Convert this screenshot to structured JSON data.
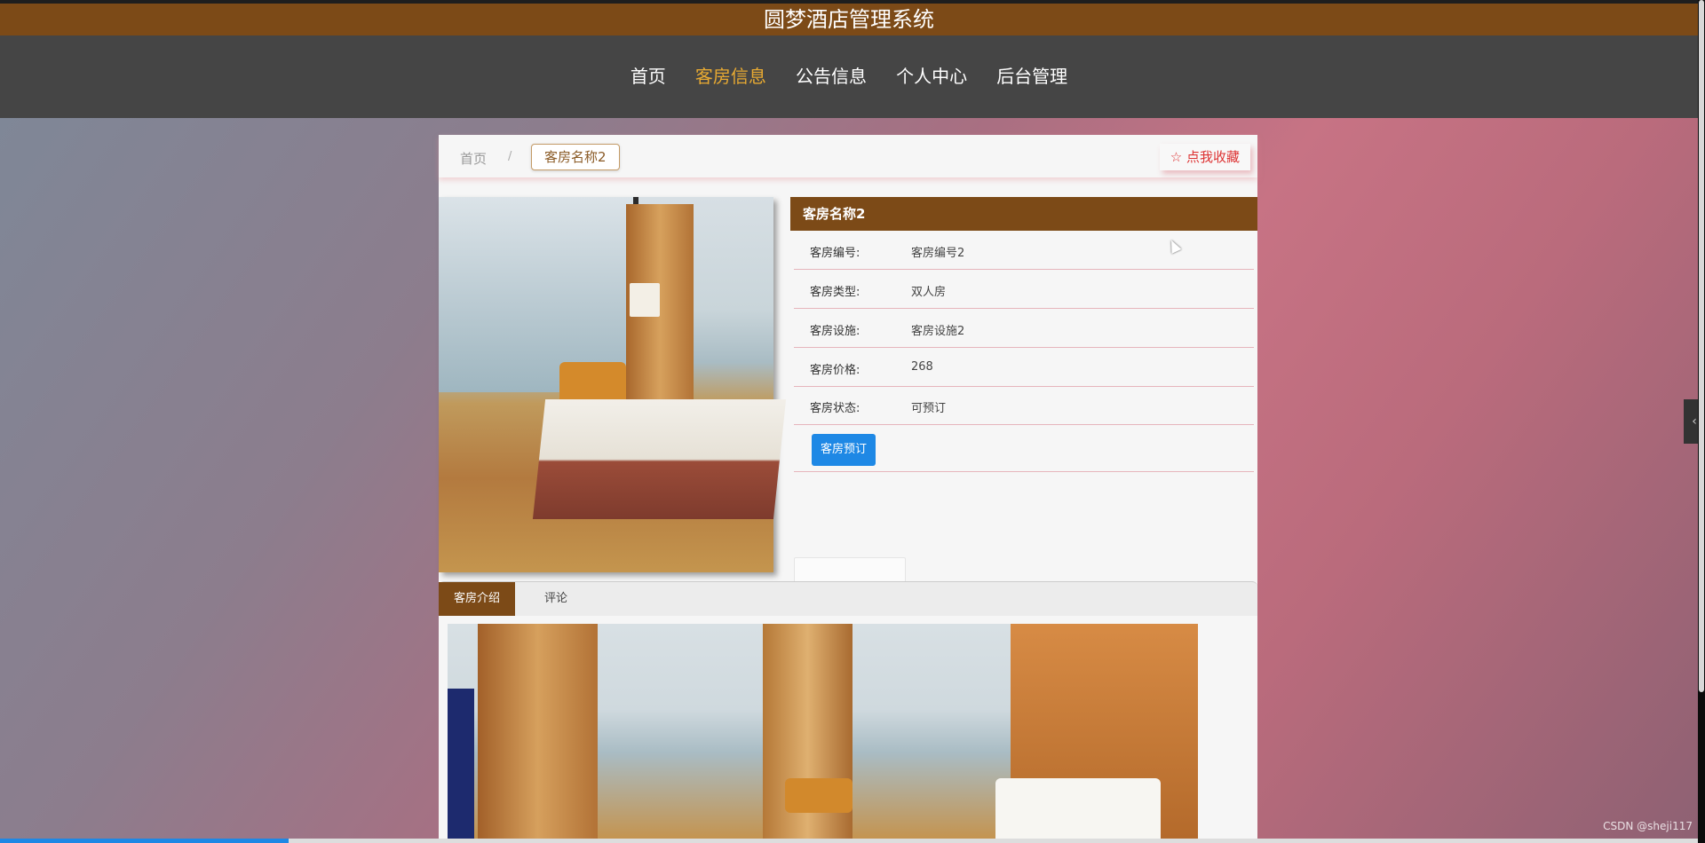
{
  "header": {
    "title": "圆梦酒店管理系统"
  },
  "nav": {
    "items": [
      "首页",
      "客房信息",
      "公告信息",
      "个人中心",
      "后台管理"
    ],
    "active_index": 1
  },
  "breadcrumb": {
    "home": "首页",
    "separator": "/",
    "current": "客房名称2"
  },
  "favorite": {
    "label": "☆ 点我收藏"
  },
  "room": {
    "name": "客房名称2",
    "fields": [
      {
        "label": "客房编号:",
        "value": "客房编号2"
      },
      {
        "label": "客房类型:",
        "value": "双人房"
      },
      {
        "label": "客房设施:",
        "value": "客房设施2"
      },
      {
        "label": "客房价格:",
        "value": "268"
      },
      {
        "label": "客房状态:",
        "value": "可预订"
      }
    ],
    "book_label": "客房预订"
  },
  "tabs": {
    "intro": "客房介绍",
    "comments": "评论"
  },
  "watermark": "CSDN @sheji117",
  "page_progress": 0.17,
  "colors": {
    "brand": "#7c4a17",
    "nav_active": "#e8aa32",
    "primary_button": "#1e88e5",
    "favorite": "#dd3333"
  }
}
